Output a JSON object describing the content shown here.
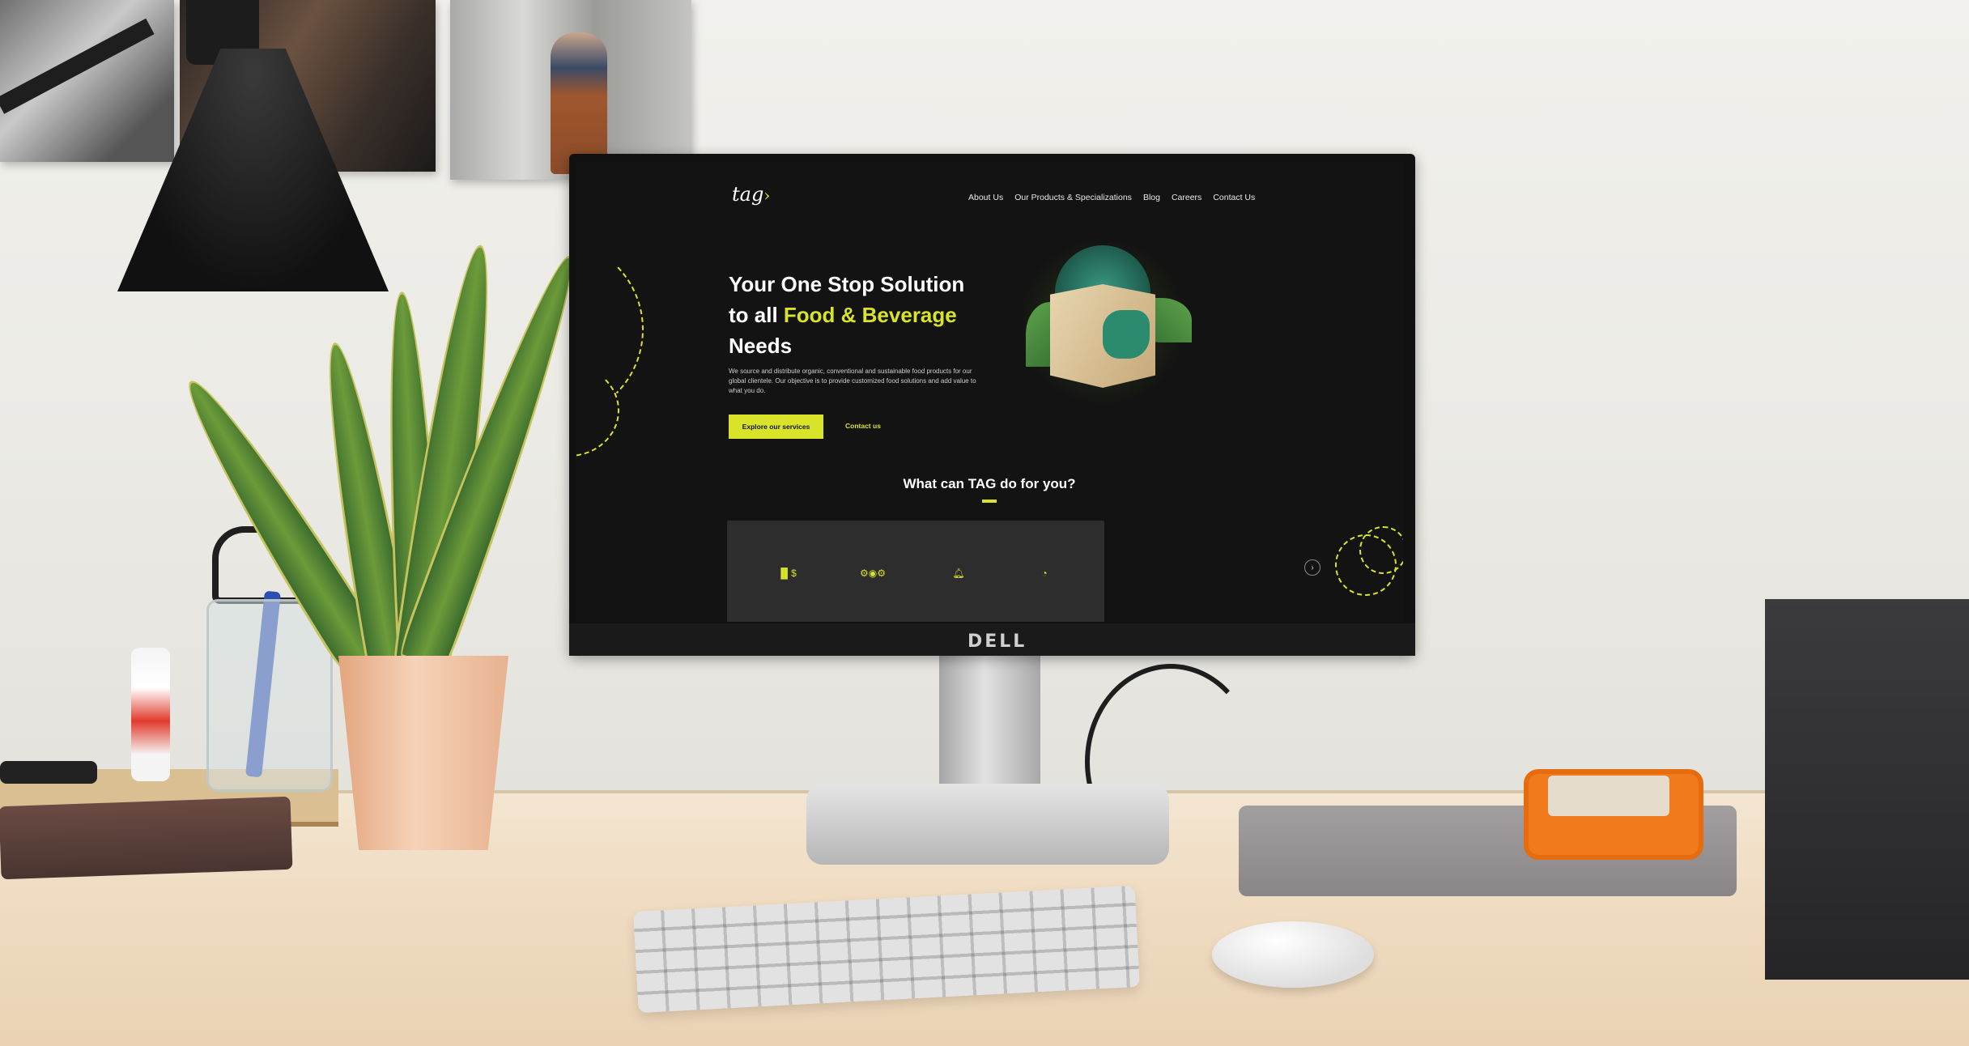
{
  "site": {
    "logo": "tag",
    "nav": [
      "About Us",
      "Our Products & Specializations",
      "Blog",
      "Careers",
      "Contact Us"
    ],
    "hero": {
      "title_line1": "Your One Stop Solution",
      "title_line2_prefix": "to all ",
      "title_accent": "Food & Beverage",
      "title_line3": "Needs",
      "description": "We source and distribute organic, conventional and sustainable food products for our global clientele. Our objective is to provide customized food solutions and add value to what you do.",
      "primary_button": "Explore our services",
      "secondary_link": "Contact us"
    },
    "section_title": "What can TAG do for you?",
    "cards": [
      {
        "icon": "bar-chart-icon",
        "glyph": "▐▌$"
      },
      {
        "icon": "network-icon",
        "glyph": "⚙◉⚙"
      },
      {
        "icon": "bell-icon",
        "glyph": "🔔︎"
      },
      {
        "icon": "gauge-icon",
        "glyph": "◔"
      }
    ],
    "carousel_next": "›"
  },
  "monitor": {
    "brand": "DELL"
  },
  "colors": {
    "accent": "#d8e32a",
    "background": "#131313",
    "card": "#2d2d2d"
  }
}
